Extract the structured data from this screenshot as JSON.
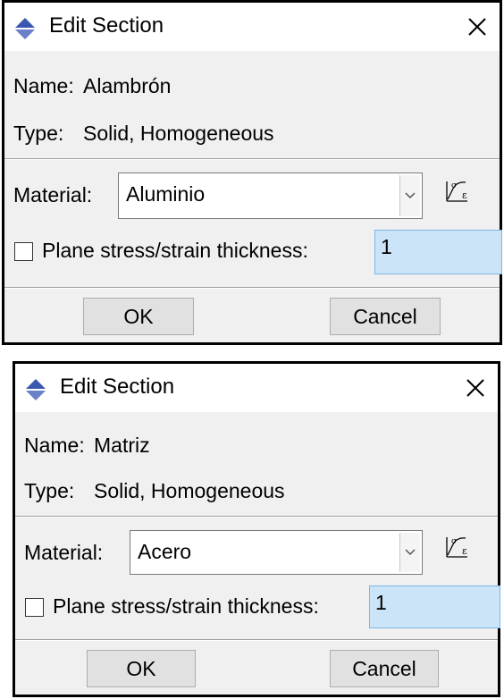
{
  "dialogs": [
    {
      "title": "Edit Section",
      "name_label": "Name:",
      "name_value": "Alambrón",
      "type_label": "Type:",
      "type_value": "Solid, Homogeneous",
      "material_label": "Material:",
      "material_value": "Aluminio",
      "checkbox_label": "Plane stress/strain thickness:",
      "checkbox_checked": false,
      "thickness_value": "1",
      "ok_label": "OK",
      "cancel_label": "Cancel"
    },
    {
      "title": "Edit Section",
      "name_label": "Name:",
      "name_value": "Matriz",
      "type_label": "Type:",
      "type_value": "Solid, Homogeneous",
      "material_label": "Material:",
      "material_value": "Acero",
      "checkbox_label": "Plane stress/strain thickness:",
      "checkbox_checked": false,
      "thickness_value": "1",
      "ok_label": "OK",
      "cancel_label": "Cancel"
    }
  ],
  "icons": {
    "app": "abaqus-diamond-icon",
    "close": "close-icon",
    "material_manager": "stress-strain-curve-icon",
    "combo_arrow": "chevron-down-icon"
  },
  "colors": {
    "app_icon_top": "#3a58b0",
    "app_icon_bottom": "#6a80c8",
    "thickness_highlight": "#cce4f7"
  }
}
